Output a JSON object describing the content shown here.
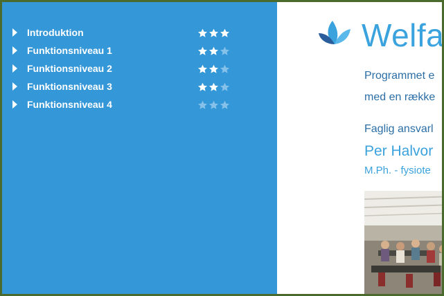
{
  "menu": {
    "items": [
      {
        "label": "Introduktion",
        "rating": 3,
        "max": 3
      },
      {
        "label": "Funktionsniveau 1",
        "rating": 2,
        "max": 3
      },
      {
        "label": "Funktionsniveau 2",
        "rating": 2,
        "max": 3
      },
      {
        "label": "Funktionsniveau 3",
        "rating": 2,
        "max": 3
      },
      {
        "label": "Funktionsniveau 4",
        "rating": 0,
        "max": 3
      }
    ]
  },
  "content": {
    "brand": "Welfa",
    "intro_line1": "Programmet e",
    "intro_line2": "med en række",
    "responsible_label": "Faglig ansvarl",
    "person_name": "Per Halvor",
    "person_title": "M.Ph. - fysiote"
  },
  "colors": {
    "panel_blue": "#3497d8",
    "brand_blue": "#3aa2dd",
    "text_blue": "#2b6ea6",
    "star_filled": "#ffffff",
    "star_empty": "#86c1ea",
    "frame": "#4a6a2e"
  },
  "icons": {
    "menu_arrow": "triangle-right-icon",
    "rating": "star-icon",
    "logo": "leaf-logo-icon"
  }
}
